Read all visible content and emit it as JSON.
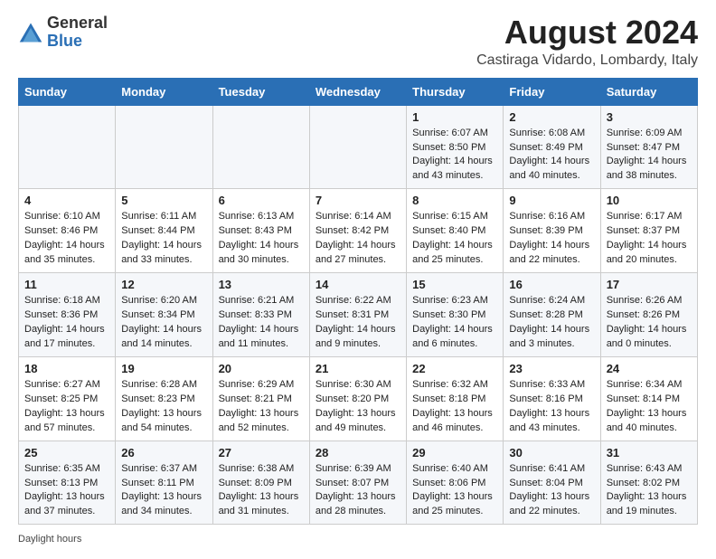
{
  "logo": {
    "general": "General",
    "blue": "Blue"
  },
  "title": "August 2024",
  "subtitle": "Castiraga Vidardo, Lombardy, Italy",
  "days_of_week": [
    "Sunday",
    "Monday",
    "Tuesday",
    "Wednesday",
    "Thursday",
    "Friday",
    "Saturday"
  ],
  "footer": "Daylight hours",
  "weeks": [
    [
      {
        "day": "",
        "info": ""
      },
      {
        "day": "",
        "info": ""
      },
      {
        "day": "",
        "info": ""
      },
      {
        "day": "",
        "info": ""
      },
      {
        "day": "1",
        "info": "Sunrise: 6:07 AM\nSunset: 8:50 PM\nDaylight: 14 hours and 43 minutes."
      },
      {
        "day": "2",
        "info": "Sunrise: 6:08 AM\nSunset: 8:49 PM\nDaylight: 14 hours and 40 minutes."
      },
      {
        "day": "3",
        "info": "Sunrise: 6:09 AM\nSunset: 8:47 PM\nDaylight: 14 hours and 38 minutes."
      }
    ],
    [
      {
        "day": "4",
        "info": "Sunrise: 6:10 AM\nSunset: 8:46 PM\nDaylight: 14 hours and 35 minutes."
      },
      {
        "day": "5",
        "info": "Sunrise: 6:11 AM\nSunset: 8:44 PM\nDaylight: 14 hours and 33 minutes."
      },
      {
        "day": "6",
        "info": "Sunrise: 6:13 AM\nSunset: 8:43 PM\nDaylight: 14 hours and 30 minutes."
      },
      {
        "day": "7",
        "info": "Sunrise: 6:14 AM\nSunset: 8:42 PM\nDaylight: 14 hours and 27 minutes."
      },
      {
        "day": "8",
        "info": "Sunrise: 6:15 AM\nSunset: 8:40 PM\nDaylight: 14 hours and 25 minutes."
      },
      {
        "day": "9",
        "info": "Sunrise: 6:16 AM\nSunset: 8:39 PM\nDaylight: 14 hours and 22 minutes."
      },
      {
        "day": "10",
        "info": "Sunrise: 6:17 AM\nSunset: 8:37 PM\nDaylight: 14 hours and 20 minutes."
      }
    ],
    [
      {
        "day": "11",
        "info": "Sunrise: 6:18 AM\nSunset: 8:36 PM\nDaylight: 14 hours and 17 minutes."
      },
      {
        "day": "12",
        "info": "Sunrise: 6:20 AM\nSunset: 8:34 PM\nDaylight: 14 hours and 14 minutes."
      },
      {
        "day": "13",
        "info": "Sunrise: 6:21 AM\nSunset: 8:33 PM\nDaylight: 14 hours and 11 minutes."
      },
      {
        "day": "14",
        "info": "Sunrise: 6:22 AM\nSunset: 8:31 PM\nDaylight: 14 hours and 9 minutes."
      },
      {
        "day": "15",
        "info": "Sunrise: 6:23 AM\nSunset: 8:30 PM\nDaylight: 14 hours and 6 minutes."
      },
      {
        "day": "16",
        "info": "Sunrise: 6:24 AM\nSunset: 8:28 PM\nDaylight: 14 hours and 3 minutes."
      },
      {
        "day": "17",
        "info": "Sunrise: 6:26 AM\nSunset: 8:26 PM\nDaylight: 14 hours and 0 minutes."
      }
    ],
    [
      {
        "day": "18",
        "info": "Sunrise: 6:27 AM\nSunset: 8:25 PM\nDaylight: 13 hours and 57 minutes."
      },
      {
        "day": "19",
        "info": "Sunrise: 6:28 AM\nSunset: 8:23 PM\nDaylight: 13 hours and 54 minutes."
      },
      {
        "day": "20",
        "info": "Sunrise: 6:29 AM\nSunset: 8:21 PM\nDaylight: 13 hours and 52 minutes."
      },
      {
        "day": "21",
        "info": "Sunrise: 6:30 AM\nSunset: 8:20 PM\nDaylight: 13 hours and 49 minutes."
      },
      {
        "day": "22",
        "info": "Sunrise: 6:32 AM\nSunset: 8:18 PM\nDaylight: 13 hours and 46 minutes."
      },
      {
        "day": "23",
        "info": "Sunrise: 6:33 AM\nSunset: 8:16 PM\nDaylight: 13 hours and 43 minutes."
      },
      {
        "day": "24",
        "info": "Sunrise: 6:34 AM\nSunset: 8:14 PM\nDaylight: 13 hours and 40 minutes."
      }
    ],
    [
      {
        "day": "25",
        "info": "Sunrise: 6:35 AM\nSunset: 8:13 PM\nDaylight: 13 hours and 37 minutes."
      },
      {
        "day": "26",
        "info": "Sunrise: 6:37 AM\nSunset: 8:11 PM\nDaylight: 13 hours and 34 minutes."
      },
      {
        "day": "27",
        "info": "Sunrise: 6:38 AM\nSunset: 8:09 PM\nDaylight: 13 hours and 31 minutes."
      },
      {
        "day": "28",
        "info": "Sunrise: 6:39 AM\nSunset: 8:07 PM\nDaylight: 13 hours and 28 minutes."
      },
      {
        "day": "29",
        "info": "Sunrise: 6:40 AM\nSunset: 8:06 PM\nDaylight: 13 hours and 25 minutes."
      },
      {
        "day": "30",
        "info": "Sunrise: 6:41 AM\nSunset: 8:04 PM\nDaylight: 13 hours and 22 minutes."
      },
      {
        "day": "31",
        "info": "Sunrise: 6:43 AM\nSunset: 8:02 PM\nDaylight: 13 hours and 19 minutes."
      }
    ]
  ]
}
